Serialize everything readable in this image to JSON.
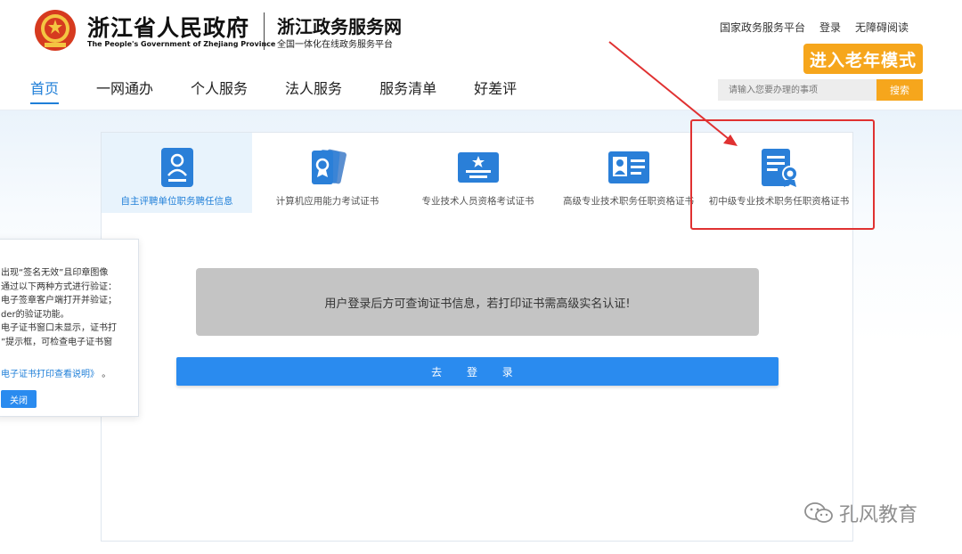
{
  "header": {
    "gov_name": "浙江省人民政府",
    "gov_name_en": "The People's Government of Zhejiang Province",
    "site_name": "浙江政务服务网",
    "site_subtitle": "全国一体化在线政务服务平台",
    "top_links": [
      "国家政务服务平台",
      "登录",
      "无障碍阅读"
    ],
    "elder_mode": "进入老年模式"
  },
  "nav": {
    "items": [
      "首页",
      "一网通办",
      "个人服务",
      "法人服务",
      "服务清单",
      "好差评"
    ],
    "active_index": 0
  },
  "search": {
    "placeholder": "请输入您要办理的事项",
    "button": "搜索"
  },
  "tabs": {
    "items": [
      {
        "label": "自主评聘单位职务聘任信息",
        "icon": "id-card-icon"
      },
      {
        "label": "计算机应用能力考试证书",
        "icon": "certificate-medal-icon"
      },
      {
        "label": "专业技术人员资格考试证书",
        "icon": "certificate-star-icon"
      },
      {
        "label": "高级专业技术职务任职资格证书",
        "icon": "profile-card-icon"
      },
      {
        "label": "初中级专业技术职务任职资格证书",
        "icon": "document-seal-icon"
      }
    ],
    "active_index": 0
  },
  "notice": "用户登录后方可查询证书信息，若打印证书需高级实名认证!",
  "login_button": "去 登 录",
  "popup": {
    "lines": [
      "出现“签名无效”且印章图像",
      "通过以下两种方式进行验证：",
      "电子签章客户端打开并验证；",
      "der的验证功能。",
      "电子证书窗口未显示，证书打",
      "”提示框，可检查电子证书窗"
    ],
    "link_text": "电子证书打印查看说明》",
    "link_suffix": "。",
    "close_button": "关闭"
  },
  "watermark": "孔风教育",
  "colors": {
    "accent_blue": "#1f7fd8",
    "button_blue": "#2a8bef",
    "orange": "#f6a61c",
    "annotation_red": "#e03131"
  }
}
